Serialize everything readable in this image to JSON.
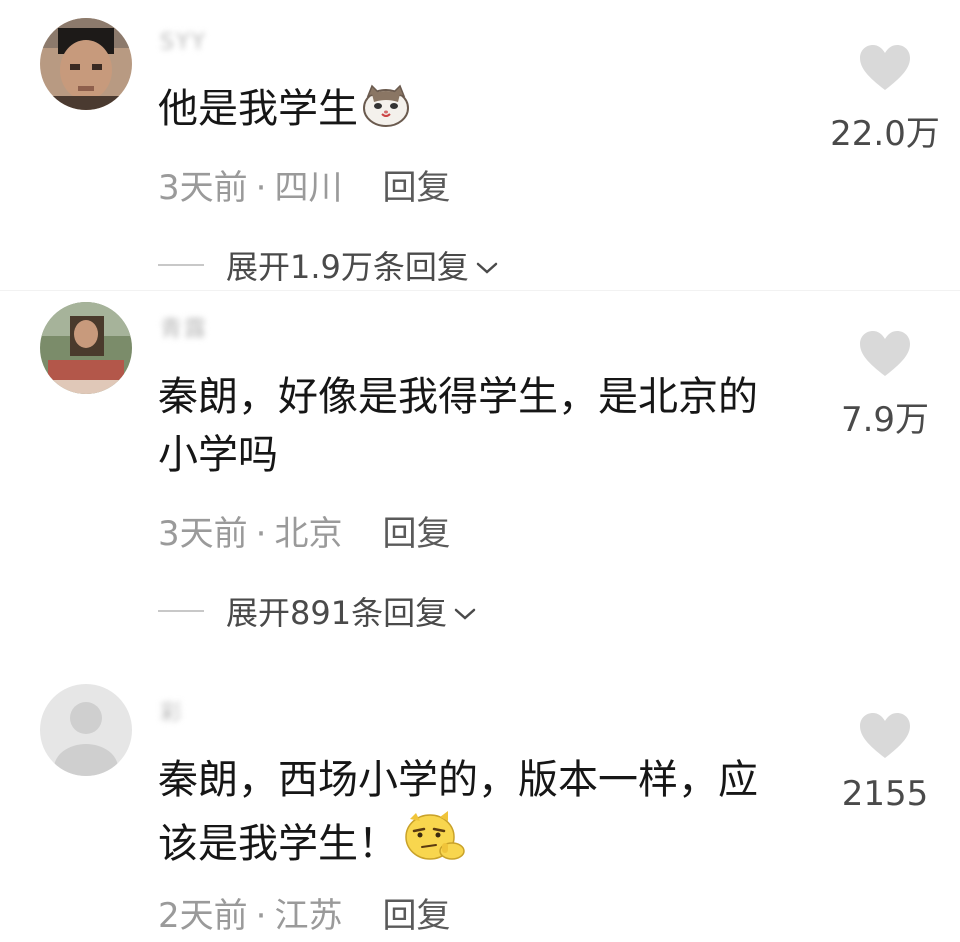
{
  "comments": [
    {
      "username": "SYY",
      "content_lines": [
        "他是我学生"
      ],
      "emoji": "cat-emoji",
      "time": "3天前",
      "location": "四川",
      "reply_label": "回复",
      "likes": "22.0万",
      "expand_label": "展开1.9万条回复"
    },
    {
      "username": "青露",
      "content_lines": [
        "秦朗，好像是我得学生，是北京的",
        "小学吗"
      ],
      "time": "3天前",
      "location": "北京",
      "reply_label": "回复",
      "likes": "7.9万",
      "expand_label": "展开891条回复"
    },
    {
      "username": "彩",
      "content_lines": [
        "秦朗，西场小学的，版本一样，应",
        "该是我学生！"
      ],
      "emoji": "thinking-emoji",
      "time": "2天前",
      "location": "江苏",
      "reply_label": "回复",
      "likes": "2155"
    }
  ],
  "icons": {
    "like": "heart-icon",
    "expand": "chevron-down-icon"
  },
  "colors": {
    "text": "#161616",
    "meta": "#9a9a9a",
    "heart": "#d9d9d9"
  }
}
